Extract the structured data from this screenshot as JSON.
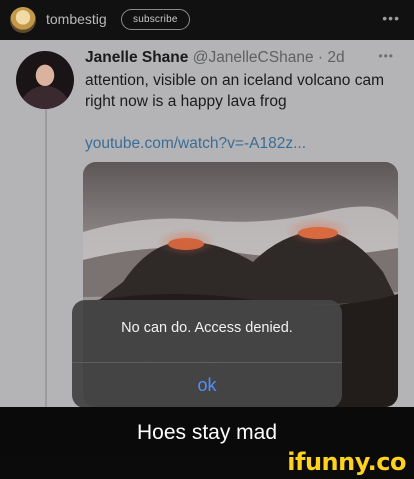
{
  "post_header": {
    "username": "tombestig",
    "subscribe_label": "subscribe",
    "more_icon": "more-horizontal-icon"
  },
  "tweet": {
    "display_name": "Janelle Shane",
    "handle_and_time": "@JanelleCShane · 2d",
    "text": "attention, visible on an iceland volcano cam right now is a happy lava frog",
    "link": "youtube.com/watch?v=-A182z...",
    "more_icon": "more-horizontal-icon"
  },
  "alert": {
    "message": "No can do. Access denied.",
    "button_label": "ok"
  },
  "caption": "Hoes stay mad",
  "watermark": "ifunny.co",
  "colors": {
    "link_blue": "#3a6d96",
    "ios_button_blue": "#4f90ff",
    "watermark_yellow": "#ffd21e"
  }
}
